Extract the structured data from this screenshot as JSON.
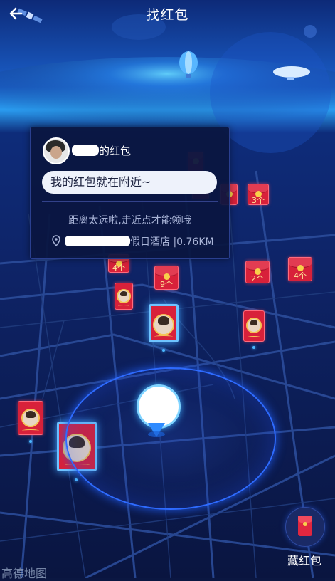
{
  "header": {
    "title": "找红包"
  },
  "card": {
    "owner_suffix": "的红包",
    "message": "我的红包就在附近~",
    "hint": "距离太远啦,走近点才能领哦",
    "address": "假日酒店 |0.76KM"
  },
  "envelopes": [
    {
      "count": "4个"
    },
    {
      "count": "9个"
    },
    {
      "count": "3个"
    },
    {
      "count": "2个"
    },
    {
      "count": "4个"
    }
  ],
  "bottom": {
    "hide_label": "藏红包",
    "map_brand": "高德地图"
  },
  "colors": {
    "accent_red": "#d8213a",
    "map_bg": "#0b1742",
    "glow": "#2e6bff"
  }
}
